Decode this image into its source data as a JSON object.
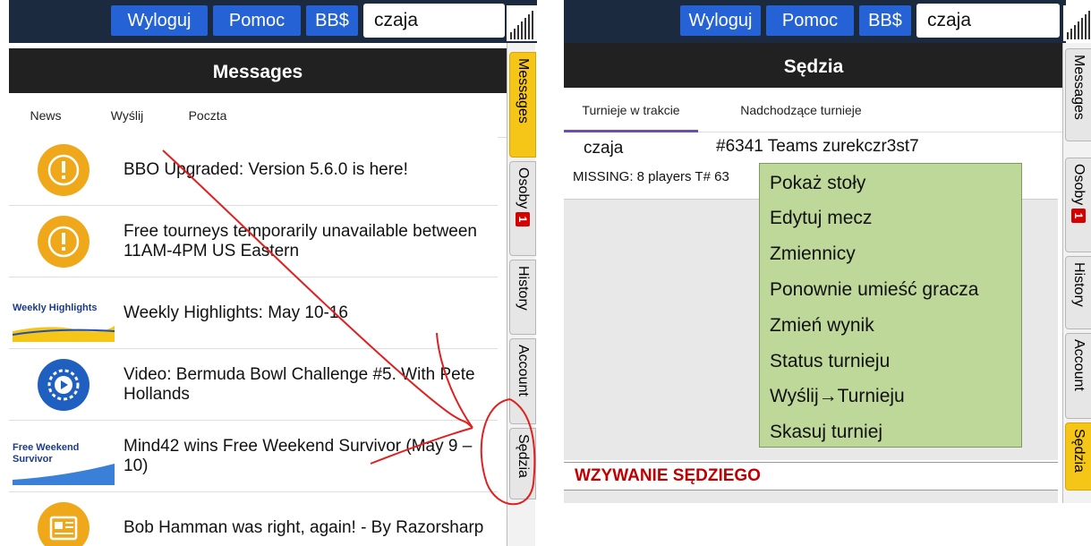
{
  "left": {
    "topbar": {
      "logout": "Wyloguj",
      "help": "Pomoc",
      "bb": "BB$",
      "search_value": "czaja"
    },
    "header_title": "Messages",
    "subtabs": [
      "News",
      "Wyślij",
      "Poczta"
    ],
    "news": [
      {
        "icon": "warning-icon",
        "text": "BBO Upgraded: Version 5.6.0 is here!"
      },
      {
        "icon": "warning-icon",
        "text": "Free tourneys temporarily unavailable between 11AM-4PM US Eastern"
      },
      {
        "icon": "weekly-highlights-thumbnail",
        "thumb_label": "Weekly Highlights",
        "text": "Weekly Highlights: May 10-16"
      },
      {
        "icon": "video-play-icon",
        "text": "Video: Bermuda Bowl Challenge #5. With Pete Hollands"
      },
      {
        "icon": "free-weekend-survivor-thumbnail",
        "thumb_label": "Free Weekend Survivor",
        "text": "Mind42 wins Free Weekend Survivor (May 9 – 10)"
      },
      {
        "icon": "article-icon",
        "text": "Bob Hamman was right, again! - By Razorsharp"
      }
    ],
    "sidebar": [
      {
        "label": "Messages",
        "active": true
      },
      {
        "label": "Osoby",
        "badge": "1"
      },
      {
        "label": "History"
      },
      {
        "label": "Account"
      },
      {
        "label": "Sędzia"
      }
    ]
  },
  "right": {
    "topbar": {
      "logout": "Wyloguj",
      "help": "Pomoc",
      "bb": "BB$",
      "search_value": "czaja"
    },
    "header_title": "Sędzia",
    "subtabs": [
      "Turnieje w trakcie",
      "Nadchodzące turnieje"
    ],
    "row": {
      "user": "czaja",
      "tournament": "#6341 Teams zurekczr3st7",
      "missing": "MISSING: 8 players T# 63"
    },
    "context_menu": [
      "Pokaż stoły",
      "Edytuj mecz",
      "Zmiennicy",
      "Ponownie umieść gracza",
      "Zmień wynik",
      "Status turnieju",
      "Wyślij→Turnieju",
      "Skasuj turniej"
    ],
    "referee_call": "WZYWANIE SĘDZIEGO",
    "sidebar": [
      {
        "label": "Messages"
      },
      {
        "label": "Osoby",
        "badge": "1"
      },
      {
        "label": "History"
      },
      {
        "label": "Account"
      },
      {
        "label": "Sędzia",
        "active": true
      }
    ]
  },
  "colors": {
    "topbar": "#1c2a40",
    "button": "#2462d6",
    "header": "#212121",
    "active_tab": "#f5c518",
    "warning_icon": "#f0a81b",
    "menu_bg": "#bed89a",
    "referee_text": "#c00000",
    "annotation": "#e02020",
    "badge": "#d40000"
  }
}
